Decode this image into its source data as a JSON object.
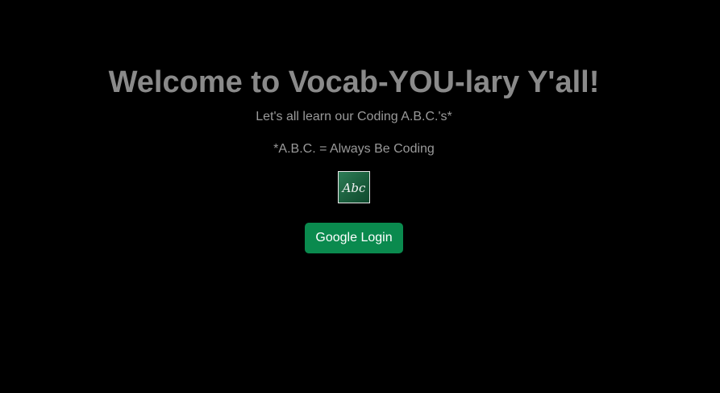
{
  "welcome": {
    "title": "Welcome to Vocab-YOU-lary Y'all!",
    "subtitle": "Let's all learn our Coding A.B.C.'s*",
    "footnote": "*A.B.C. = Always Be Coding"
  },
  "logo": {
    "text": "Abc",
    "icon": "abc-chalkboard-icon",
    "color": "#1f6b45"
  },
  "auth": {
    "login_label": "Google Login",
    "button_color": "#0a8a4e"
  }
}
